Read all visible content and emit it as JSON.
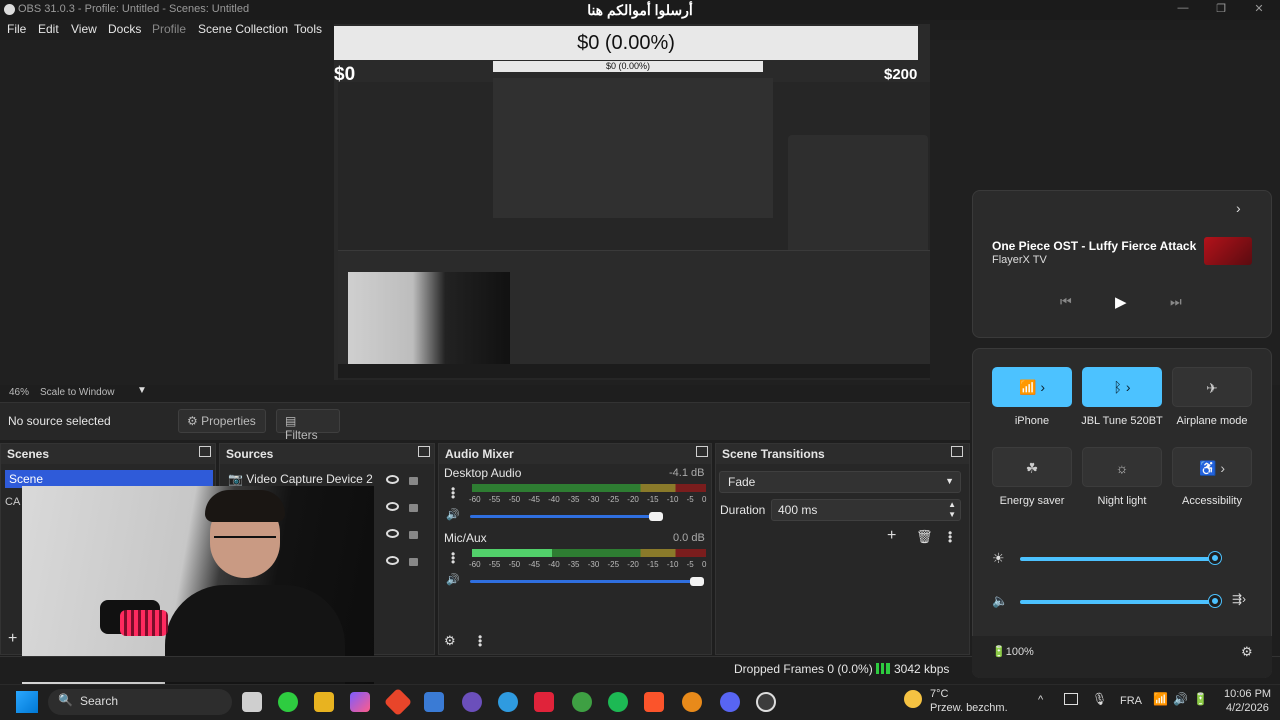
{
  "window": {
    "title": "OBS 31.0.3 - Profile: Untitled - Scenes: Untitled",
    "banner_text": "أرسلوا أموالكم هنا",
    "controls": [
      "—",
      "❐",
      "✕"
    ]
  },
  "menu": [
    "File",
    "Edit",
    "View",
    "Docks",
    "Profile",
    "Scene Collection",
    "Tools"
  ],
  "preview": {
    "donation_text": "$0 (0.00%)",
    "left_amount": "$0",
    "right_amount": "$200",
    "mini_donation_text": "$0 (0.00%)"
  },
  "scale": {
    "zoom": "46%",
    "mode": "Scale to Window"
  },
  "source_toolbar": {
    "status": "No source selected",
    "properties_label": "Properties",
    "filters_label": "Filters"
  },
  "scenes": {
    "title": "Scenes",
    "items": [
      "Scene",
      "CA"
    ]
  },
  "sources": {
    "title": "Sources",
    "items": [
      "Video Capture Device 2"
    ]
  },
  "audio_mixer": {
    "title": "Audio Mixer",
    "ticks": "-60 -55 -50 -45 -40 -35 -30 -25 -20 -15 -10 -5 0",
    "channels": [
      {
        "name": "Desktop Audio",
        "db": "-4.1 dB",
        "level": 0.0,
        "volume": 0.98
      },
      {
        "name": "Mic/Aux",
        "db": "0.0 dB",
        "level": 0.0,
        "volume": 1.0
      }
    ]
  },
  "transitions": {
    "title": "Scene Transitions",
    "selected": "Fade",
    "duration_label": "Duration",
    "duration_value": "400 ms"
  },
  "status": {
    "dropped": "Dropped Frames 0 (0.0%)",
    "kbps": "3042 kbps"
  },
  "media": {
    "track": "One Piece OST - Luffy Fierce Attack (...",
    "artist": "FlayerX TV"
  },
  "quick_settings": {
    "tiles": [
      {
        "label": "iPhone",
        "on": true
      },
      {
        "label": "JBL Tune 520BT",
        "on": true
      },
      {
        "label": "Airplane mode",
        "on": false
      },
      {
        "label": "Energy saver",
        "on": false
      },
      {
        "label": "Night light",
        "on": false
      },
      {
        "label": "Accessibility",
        "on": false
      }
    ],
    "brightness": 1.0,
    "volume": 1.0,
    "battery": "100%"
  },
  "taskbar": {
    "search_placeholder": "Search",
    "weather_temp": "7°C",
    "weather_desc": "Przew. bezchm.",
    "language": "FRA",
    "time": "10:06 PM",
    "date": "4/2/2026"
  },
  "colors": {
    "accent": "#4cc2ff",
    "obs_selection": "#2f5bd9"
  }
}
